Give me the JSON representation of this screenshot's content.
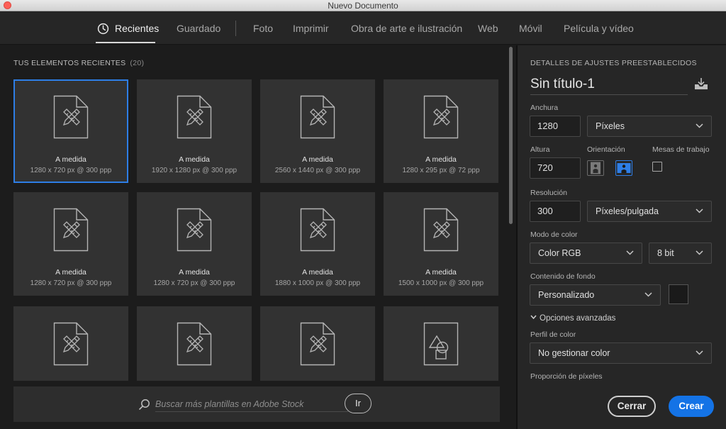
{
  "window": {
    "title": "Nuevo Documento"
  },
  "tabs": [
    {
      "label": "Recientes",
      "active": true
    },
    {
      "label": "Guardado"
    },
    {
      "label": "Foto"
    },
    {
      "label": "Imprimir"
    },
    {
      "label": "Obra de arte e ilustración"
    },
    {
      "label": "Web"
    },
    {
      "label": "Móvil"
    },
    {
      "label": "Película y vídeo"
    }
  ],
  "recent": {
    "section_title": "TUS ELEMENTOS RECIENTES",
    "count": "(20)",
    "items": [
      {
        "name": "A medida",
        "size": "1280 x 720 px @ 300 ppp",
        "icon": "custom-doc-icon",
        "selected": true
      },
      {
        "name": "A medida",
        "size": "1920 x 1280 px @ 300 ppp",
        "icon": "custom-doc-icon"
      },
      {
        "name": "A medida",
        "size": "2560 x 1440 px @ 300 ppp",
        "icon": "custom-doc-icon"
      },
      {
        "name": "A medida",
        "size": "1280 x 295 px @ 72 ppp",
        "icon": "custom-doc-icon"
      },
      {
        "name": "A medida",
        "size": "1280 x 720 px @ 300 ppp",
        "icon": "custom-doc-icon"
      },
      {
        "name": "A medida",
        "size": "1280 x 720 px @ 300 ppp",
        "icon": "custom-doc-icon"
      },
      {
        "name": "A medida",
        "size": "1880 x 1000 px @ 300 ppp",
        "icon": "custom-doc-icon"
      },
      {
        "name": "A medida",
        "size": "1500 x 1000 px @ 300 ppp",
        "icon": "custom-doc-icon"
      },
      {
        "name": "",
        "size": "",
        "icon": "custom-doc-icon"
      },
      {
        "name": "",
        "size": "",
        "icon": "custom-doc-icon"
      },
      {
        "name": "",
        "size": "",
        "icon": "custom-doc-icon"
      },
      {
        "name": "",
        "size": "",
        "icon": "shapes-doc-icon"
      }
    ]
  },
  "search": {
    "placeholder": "Buscar más plantillas en Adobe Stock",
    "go_label": "Ir"
  },
  "details": {
    "section_title": "DETALLES DE AJUSTES PREESTABLECIDOS",
    "doc_name": "Sin título-1",
    "width_label": "Anchura",
    "width_value": "1280",
    "width_unit": "Píxeles",
    "height_label": "Altura",
    "height_value": "720",
    "orientation_label": "Orientación",
    "artboards_label": "Mesas de trabajo",
    "orientation_selected": "landscape",
    "artboards_checked": false,
    "resolution_label": "Resolución",
    "resolution_value": "300",
    "resolution_unit": "Píxeles/pulgada",
    "color_mode_label": "Modo de color",
    "color_mode": "Color RGB",
    "bit_depth": "8 bit",
    "background_label": "Contenido de fondo",
    "background_value": "Personalizado",
    "background_color": "#1a1a1a",
    "advanced_label": "Opciones avanzadas",
    "color_profile_label": "Perfil de color",
    "color_profile_value": "No gestionar color",
    "pixel_ratio_label": "Proporción de píxeles",
    "close_label": "Cerrar",
    "create_label": "Crear"
  },
  "colors": {
    "accent": "#1473e6",
    "selection": "#2e7ee6"
  }
}
